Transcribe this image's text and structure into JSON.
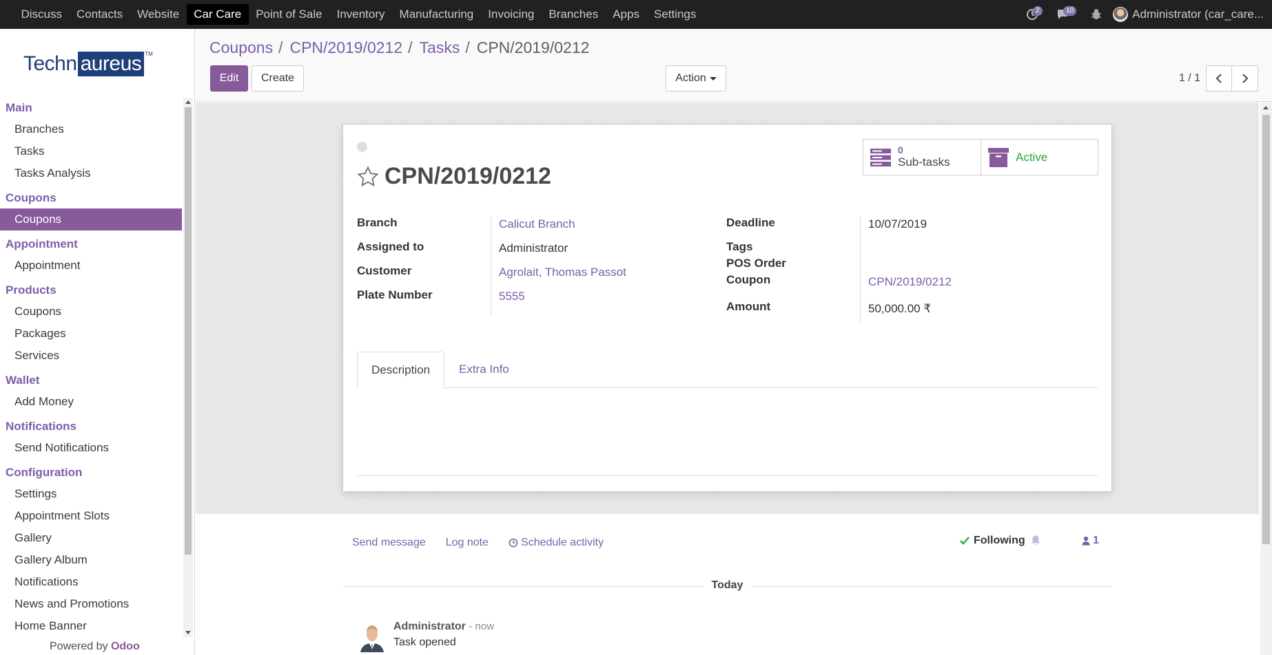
{
  "topbar": {
    "menu": [
      "Discuss",
      "Contacts",
      "Website",
      "Car Care",
      "Point of Sale",
      "Inventory",
      "Manufacturing",
      "Invoicing",
      "Branches",
      "Apps",
      "Settings"
    ],
    "active_menu": "Car Care",
    "activity_count": "2",
    "message_count": "10",
    "user": "Administrator (car_care..."
  },
  "logo": {
    "part1": "Techn",
    "part2": "aureus",
    "tm": "TM"
  },
  "sidebar": {
    "sections": [
      {
        "title": "Main",
        "items": [
          "Branches",
          "Tasks",
          "Tasks Analysis"
        ]
      },
      {
        "title": "Coupons",
        "items": [
          "Coupons"
        ]
      },
      {
        "title": "Appointment",
        "items": [
          "Appointment"
        ]
      },
      {
        "title": "Products",
        "items": [
          "Coupons",
          "Packages",
          "Services"
        ]
      },
      {
        "title": "Wallet",
        "items": [
          "Add Money"
        ]
      },
      {
        "title": "Notifications",
        "items": [
          "Send Notifications"
        ]
      },
      {
        "title": "Configuration",
        "items": [
          "Settings",
          "Appointment Slots",
          "Gallery",
          "Gallery Album",
          "Notifications",
          "News and Promotions",
          "Home Banner"
        ]
      }
    ],
    "active_item": "Coupons",
    "powered_prefix": "Powered by",
    "powered_brand": "Odoo"
  },
  "breadcrumb": {
    "items": [
      "Coupons",
      "CPN/2019/0212",
      "Tasks"
    ],
    "current": "CPN/2019/0212",
    "sep": "/"
  },
  "buttons": {
    "edit": "Edit",
    "create": "Create",
    "action": "Action"
  },
  "pager": {
    "value": "1 / 1"
  },
  "record": {
    "name": "CPN/2019/0212",
    "subtasks_count": "0",
    "subtasks_label": "Sub-tasks",
    "active_label": "Active",
    "left_fields": [
      {
        "label": "Branch",
        "value": "Calicut Branch",
        "link": true
      },
      {
        "label": "Assigned to",
        "value": "Administrator",
        "link": false
      },
      {
        "label": "Customer",
        "value": "Agrolait, Thomas Passot",
        "link": true
      },
      {
        "label": "Plate Number",
        "value": "5555",
        "link": true
      }
    ],
    "right_fields": {
      "deadline_label": "Deadline",
      "deadline": "10/07/2019",
      "tags_label": "Tags",
      "pos_order_label": "POS Order",
      "coupon_label": "Coupon",
      "coupon": "CPN/2019/0212",
      "amount_label": "Amount",
      "amount": "50,000.00 ₹"
    },
    "tabs": [
      "Description",
      "Extra Info"
    ]
  },
  "chatter": {
    "send_message": "Send message",
    "log_note": "Log note",
    "schedule_activity": "Schedule activity",
    "following": "Following",
    "followers": "1",
    "today": "Today",
    "message": {
      "author": "Administrator",
      "time": "- now",
      "body": "Task opened"
    }
  },
  "colors": {
    "brand": "#875a9b",
    "link": "#7c5ea9",
    "active_green": "#28a745",
    "topbar": "#212121"
  }
}
